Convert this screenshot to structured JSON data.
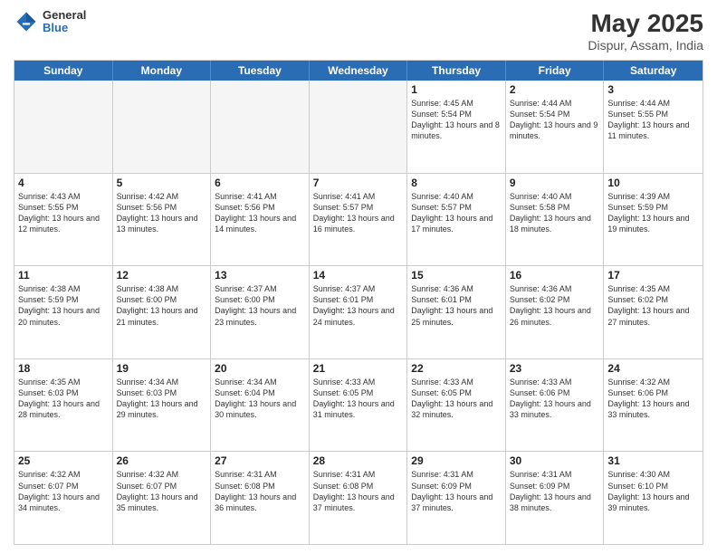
{
  "header": {
    "logo_line1": "General",
    "logo_line2": "Blue",
    "title": "May 2025",
    "subtitle": "Dispur, Assam, India"
  },
  "days_of_week": [
    "Sunday",
    "Monday",
    "Tuesday",
    "Wednesday",
    "Thursday",
    "Friday",
    "Saturday"
  ],
  "weeks": [
    [
      {
        "day": "",
        "empty": true
      },
      {
        "day": "",
        "empty": true
      },
      {
        "day": "",
        "empty": true
      },
      {
        "day": "",
        "empty": true
      },
      {
        "day": "1",
        "sunrise": "4:45 AM",
        "sunset": "5:54 PM",
        "daylight": "13 hours and 8 minutes."
      },
      {
        "day": "2",
        "sunrise": "4:44 AM",
        "sunset": "5:54 PM",
        "daylight": "13 hours and 9 minutes."
      },
      {
        "day": "3",
        "sunrise": "4:44 AM",
        "sunset": "5:55 PM",
        "daylight": "13 hours and 11 minutes."
      }
    ],
    [
      {
        "day": "4",
        "sunrise": "4:43 AM",
        "sunset": "5:55 PM",
        "daylight": "13 hours and 12 minutes."
      },
      {
        "day": "5",
        "sunrise": "4:42 AM",
        "sunset": "5:56 PM",
        "daylight": "13 hours and 13 minutes."
      },
      {
        "day": "6",
        "sunrise": "4:41 AM",
        "sunset": "5:56 PM",
        "daylight": "13 hours and 14 minutes."
      },
      {
        "day": "7",
        "sunrise": "4:41 AM",
        "sunset": "5:57 PM",
        "daylight": "13 hours and 16 minutes."
      },
      {
        "day": "8",
        "sunrise": "4:40 AM",
        "sunset": "5:57 PM",
        "daylight": "13 hours and 17 minutes."
      },
      {
        "day": "9",
        "sunrise": "4:40 AM",
        "sunset": "5:58 PM",
        "daylight": "13 hours and 18 minutes."
      },
      {
        "day": "10",
        "sunrise": "4:39 AM",
        "sunset": "5:59 PM",
        "daylight": "13 hours and 19 minutes."
      }
    ],
    [
      {
        "day": "11",
        "sunrise": "4:38 AM",
        "sunset": "5:59 PM",
        "daylight": "13 hours and 20 minutes."
      },
      {
        "day": "12",
        "sunrise": "4:38 AM",
        "sunset": "6:00 PM",
        "daylight": "13 hours and 21 minutes."
      },
      {
        "day": "13",
        "sunrise": "4:37 AM",
        "sunset": "6:00 PM",
        "daylight": "13 hours and 23 minutes."
      },
      {
        "day": "14",
        "sunrise": "4:37 AM",
        "sunset": "6:01 PM",
        "daylight": "13 hours and 24 minutes."
      },
      {
        "day": "15",
        "sunrise": "4:36 AM",
        "sunset": "6:01 PM",
        "daylight": "13 hours and 25 minutes."
      },
      {
        "day": "16",
        "sunrise": "4:36 AM",
        "sunset": "6:02 PM",
        "daylight": "13 hours and 26 minutes."
      },
      {
        "day": "17",
        "sunrise": "4:35 AM",
        "sunset": "6:02 PM",
        "daylight": "13 hours and 27 minutes."
      }
    ],
    [
      {
        "day": "18",
        "sunrise": "4:35 AM",
        "sunset": "6:03 PM",
        "daylight": "13 hours and 28 minutes."
      },
      {
        "day": "19",
        "sunrise": "4:34 AM",
        "sunset": "6:03 PM",
        "daylight": "13 hours and 29 minutes."
      },
      {
        "day": "20",
        "sunrise": "4:34 AM",
        "sunset": "6:04 PM",
        "daylight": "13 hours and 30 minutes."
      },
      {
        "day": "21",
        "sunrise": "4:33 AM",
        "sunset": "6:05 PM",
        "daylight": "13 hours and 31 minutes."
      },
      {
        "day": "22",
        "sunrise": "4:33 AM",
        "sunset": "6:05 PM",
        "daylight": "13 hours and 32 minutes."
      },
      {
        "day": "23",
        "sunrise": "4:33 AM",
        "sunset": "6:06 PM",
        "daylight": "13 hours and 33 minutes."
      },
      {
        "day": "24",
        "sunrise": "4:32 AM",
        "sunset": "6:06 PM",
        "daylight": "13 hours and 33 minutes."
      }
    ],
    [
      {
        "day": "25",
        "sunrise": "4:32 AM",
        "sunset": "6:07 PM",
        "daylight": "13 hours and 34 minutes."
      },
      {
        "day": "26",
        "sunrise": "4:32 AM",
        "sunset": "6:07 PM",
        "daylight": "13 hours and 35 minutes."
      },
      {
        "day": "27",
        "sunrise": "4:31 AM",
        "sunset": "6:08 PM",
        "daylight": "13 hours and 36 minutes."
      },
      {
        "day": "28",
        "sunrise": "4:31 AM",
        "sunset": "6:08 PM",
        "daylight": "13 hours and 37 minutes."
      },
      {
        "day": "29",
        "sunrise": "4:31 AM",
        "sunset": "6:09 PM",
        "daylight": "13 hours and 37 minutes."
      },
      {
        "day": "30",
        "sunrise": "4:31 AM",
        "sunset": "6:09 PM",
        "daylight": "13 hours and 38 minutes."
      },
      {
        "day": "31",
        "sunrise": "4:30 AM",
        "sunset": "6:10 PM",
        "daylight": "13 hours and 39 minutes."
      }
    ]
  ]
}
